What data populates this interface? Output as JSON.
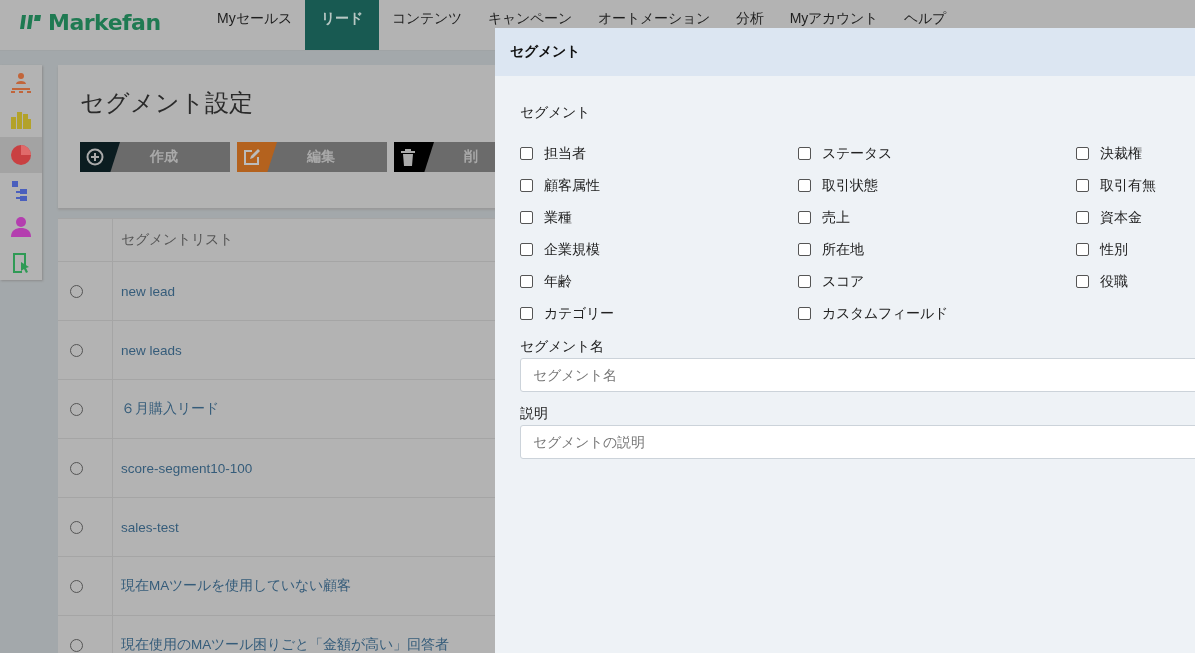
{
  "nav": {
    "logo": "Markefan",
    "items": [
      {
        "label": "Myセールス",
        "selected": false
      },
      {
        "label": "リード",
        "selected": true
      },
      {
        "label": "コンテンツ",
        "selected": false
      },
      {
        "label": "キャンペーン",
        "selected": false
      },
      {
        "label": "オートメーション",
        "selected": false
      },
      {
        "label": "分析",
        "selected": false
      },
      {
        "label": "Myアカウント",
        "selected": false
      },
      {
        "label": "ヘルプ",
        "selected": false
      }
    ]
  },
  "sidebar": {
    "items": [
      {
        "kind": "org",
        "selected": false
      },
      {
        "kind": "bars",
        "selected": false
      },
      {
        "kind": "pie",
        "selected": true
      },
      {
        "kind": "tree",
        "selected": false
      },
      {
        "kind": "person",
        "selected": false
      },
      {
        "kind": "doc",
        "selected": false
      }
    ]
  },
  "page": {
    "title": "セグメント設定",
    "buttons": [
      {
        "kind": "create",
        "label": "作成"
      },
      {
        "kind": "edit",
        "label": "編集"
      },
      {
        "kind": "delete",
        "label": "削"
      }
    ]
  },
  "table": {
    "columns": [
      "セグメントリスト"
    ],
    "rows": [
      {
        "name": "new lead",
        "selected": false
      },
      {
        "name": "new leads",
        "selected": false
      },
      {
        "name": "６月購入リード",
        "selected": false
      },
      {
        "name": "score-segment10-100",
        "selected": false
      },
      {
        "name": "sales-test",
        "selected": false
      },
      {
        "name": "現在MAツールを使用していない顧客",
        "selected": false
      },
      {
        "name": "現在使用のMAツール困りごと「金額が高い」回答者",
        "selected": false
      }
    ]
  },
  "dialog": {
    "title": "セグメント",
    "section_label": "セグメント",
    "options": [
      {
        "label": "担当者",
        "checked": false
      },
      {
        "label": "ステータス",
        "checked": false
      },
      {
        "label": "決裁権",
        "checked": false
      },
      {
        "label": "顧客属性",
        "checked": false
      },
      {
        "label": "取引状態",
        "checked": false
      },
      {
        "label": "取引有無",
        "checked": false
      },
      {
        "label": "業種",
        "checked": false
      },
      {
        "label": "売上",
        "checked": false
      },
      {
        "label": "資本金",
        "checked": false
      },
      {
        "label": "企業規模",
        "checked": false
      },
      {
        "label": "所在地",
        "checked": false
      },
      {
        "label": "性別",
        "checked": false
      },
      {
        "label": "年齢",
        "checked": false
      },
      {
        "label": "スコア",
        "checked": false
      },
      {
        "label": "役職",
        "checked": false
      },
      {
        "label": "カテゴリー",
        "checked": false
      },
      {
        "label": "カスタムフィールド",
        "checked": false
      }
    ],
    "fields": [
      {
        "label": "セグメント名",
        "placeholder": "セグメント名"
      },
      {
        "label": "説明",
        "placeholder": "セグメントの説明"
      }
    ]
  }
}
